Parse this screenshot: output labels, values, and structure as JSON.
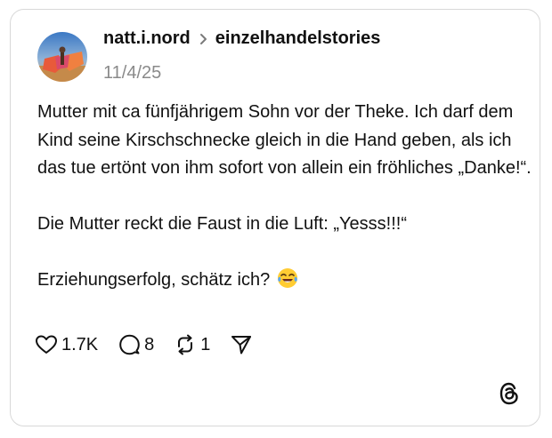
{
  "post": {
    "author": "natt.i.nord",
    "community": "einzelhandelstories",
    "date": "11/4/25",
    "paragraphs": [
      "Mutter mit ca fünfjährigem Sohn vor der Theke. Ich darf dem Kind seine Kirschschnecke gleich in die Hand geben, als ich das tue ertönt von ihm sofort von allein ein fröhliches „Danke!“.",
      "Die Mutter reckt die Faust in die Luft: „Yesss!!!“",
      "Erziehungserfolg, schätz ich?"
    ],
    "emoji": "tears-of-joy-emoji"
  },
  "actions": {
    "likes": "1.7K",
    "replies": "8",
    "reposts": "1"
  },
  "icons": {
    "like": "heart-icon",
    "reply": "speech-bubble-icon",
    "repost": "repost-icon",
    "share": "send-icon",
    "brand": "threads-logo-icon"
  }
}
